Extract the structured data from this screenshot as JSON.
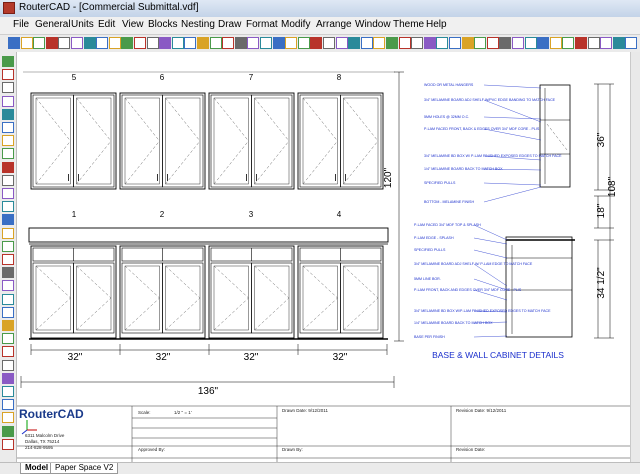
{
  "window": {
    "title": "RouterCAD - [Commercial Submittal.vdf]"
  },
  "menu": [
    "File",
    "General",
    "Units",
    "Edit",
    "View",
    "Blocks",
    "Nesting",
    "Draw",
    "Format",
    "Modify",
    "Arrange",
    "Window",
    "Theme",
    "Help"
  ],
  "toolbar_icons": [
    "new",
    "open",
    "save",
    "print",
    "cut",
    "copy",
    "paste",
    "undo",
    "redo",
    "zoom-in",
    "zoom-out",
    "zoom-window",
    "zoom-extents",
    "pan",
    "layers",
    "snap",
    "grid",
    "ortho",
    "polar",
    "text-style",
    "dim",
    "color-red",
    "color-green",
    "color-blue",
    "color-yellow"
  ],
  "drawing": {
    "wall_numbers": [
      "5",
      "6",
      "7",
      "8"
    ],
    "base_numbers": [
      "1",
      "2",
      "3",
      "4"
    ],
    "width_dims": [
      "32\"",
      "32\"",
      "32\"",
      "32\""
    ],
    "total_dim": "136\"",
    "height_dim": "120\"",
    "wall_height_dim": "36\"",
    "base_height_dim": "34 1/2\"",
    "gap_dim": "18\"",
    "wall_top_dim": "108\"",
    "details_title": "BASE & WALL CABINET DETAILS",
    "wall_notes": [
      "WOOD OR METAL HANGERS",
      "3/4\" MELAMINE BOARD ADJ SHELF W/PVC EDGE BANDING TO MATCH FACE",
      "5MM HOLES @ 32MM O.C.",
      "P-LAM FACED FRONT, BACK & EDGES OVER 3/4\" MDF CORE - PLIS",
      "3/4\" MELAMINE BD BOX W/ P-LAM FINISHED EXPOSED EDGES TO MATCH FACE",
      "1/4\" MELAMINE BOARD BACK TO MATCH BOX",
      "SPECIFIED PULLS",
      "BOTTOM - MELAMINE FINISH"
    ],
    "base_notes": [
      "P-LAM FACED 3/4\" MDF TOP & SPLASH",
      "P-LAM EDGE - SPLASH",
      "SPECIFIED PULLS",
      "3/4\" MELAMINE BOARD ADJ SHELF W/ P-LAM EDGE TO MATCH FACE",
      "5MM LINE BOR.",
      "P-LAM FRONT, BACK AND EDGES OVER 3/4\" MDF CORE - PLIS",
      "3/4\" MELAMINE BD BOX W/P-LAM FINISHED EXPOSED EDGES TO MATCH FACE",
      "1/4\" MELAMINE BOARD BACK TO MATCH BOX",
      "BASE PER FINISH"
    ]
  },
  "title_block": {
    "logo": "RouterCAD",
    "address": [
      "6311 Malcolm Drive",
      "Dallas, TX 75214",
      "214-828-9595"
    ],
    "scale_label": "Scale:",
    "scale_value": "1/2 \" = 1'",
    "drawn_date": "Drawn Date: 9/12/2011",
    "revision_date_1": "Revision Date: 9/12/2011",
    "approved_by": "Approved By:",
    "drawn_by": "Drawn By:",
    "revision_date_2": "Revision Date:"
  },
  "tabs": [
    "Model",
    "Paper Space V2"
  ]
}
